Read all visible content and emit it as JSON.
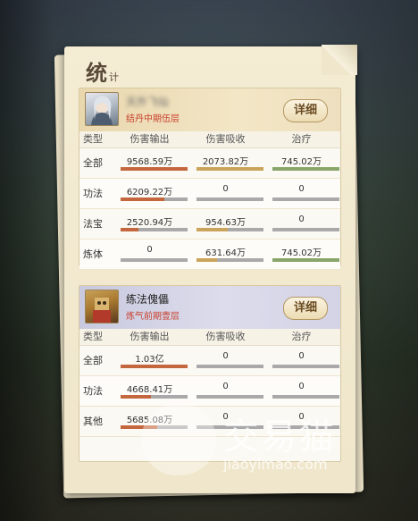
{
  "panel": {
    "title_big": "统",
    "title_small": "计"
  },
  "headers": [
    "类型",
    "伤害输出",
    "伤害吸收",
    "治疗"
  ],
  "cards": [
    {
      "name": "天外飞仙",
      "rank": "结丹中期伍层",
      "detail_label": "详细",
      "rows": [
        {
          "label": "全部",
          "cells": [
            {
              "value": "9568.59万",
              "fill": 1.0
            },
            {
              "value": "2073.82万",
              "fill": 1.0
            },
            {
              "value": "745.02万",
              "fill": 1.0
            }
          ]
        },
        {
          "label": "功法",
          "cells": [
            {
              "value": "6209.22万",
              "fill": 0.65
            },
            {
              "value": "0",
              "fill": 0
            },
            {
              "value": "0",
              "fill": 0
            }
          ]
        },
        {
          "label": "法宝",
          "cells": [
            {
              "value": "2520.94万",
              "fill": 0.26
            },
            {
              "value": "954.63万",
              "fill": 0.46
            },
            {
              "value": "0",
              "fill": 0
            }
          ]
        },
        {
          "label": "炼体",
          "cells": [
            {
              "value": "0",
              "fill": 0
            },
            {
              "value": "631.64万",
              "fill": 0.3
            },
            {
              "value": "745.02万",
              "fill": 1.0
            }
          ]
        }
      ]
    },
    {
      "name": "练法傀儡",
      "rank": "炼气前期壹层",
      "detail_label": "详细",
      "rows": [
        {
          "label": "全部",
          "cells": [
            {
              "value": "1.03亿",
              "fill": 1.0
            },
            {
              "value": "0",
              "fill": 0
            },
            {
              "value": "0",
              "fill": 0
            }
          ]
        },
        {
          "label": "功法",
          "cells": [
            {
              "value": "4668.41万",
              "fill": 0.45
            },
            {
              "value": "0",
              "fill": 0
            },
            {
              "value": "0",
              "fill": 0
            }
          ]
        },
        {
          "label": "其他",
          "cells": [
            {
              "value": "5685.08万",
              "fill": 0.55
            },
            {
              "value": "0",
              "fill": 0
            },
            {
              "value": "0",
              "fill": 0
            }
          ]
        }
      ]
    }
  ],
  "watermark": {
    "cn": "交易猫",
    "url": "jiaoyimao.com"
  },
  "colors": {
    "damage": "#c4673f",
    "absorb": "#c9a45a",
    "heal": "#8aa56a",
    "bar_bg": "#a9a9a9"
  }
}
